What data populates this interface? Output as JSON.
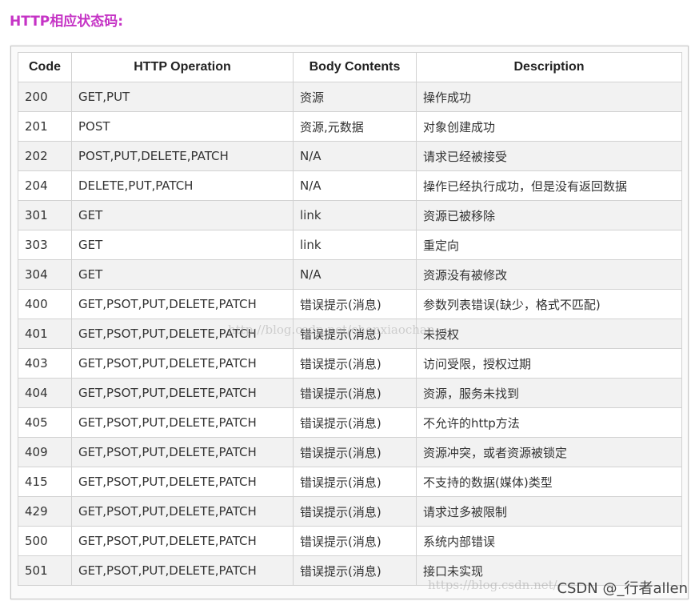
{
  "heading": "HTTP相应状态码:",
  "table": {
    "headers": [
      "Code",
      "HTTP Operation",
      "Body Contents",
      "Description"
    ],
    "rows": [
      [
        "200",
        "GET,PUT",
        "资源",
        "操作成功"
      ],
      [
        "201",
        "POST",
        "资源,元数据",
        "对象创建成功"
      ],
      [
        "202",
        "POST,PUT,DELETE,PATCH",
        "N/A",
        "请求已经被接受"
      ],
      [
        "204",
        "DELETE,PUT,PATCH",
        "N/A",
        "操作已经执行成功，但是没有返回数据"
      ],
      [
        "301",
        "GET",
        "link",
        "资源已被移除"
      ],
      [
        "303",
        "GET",
        "link",
        "重定向"
      ],
      [
        "304",
        "GET",
        "N/A",
        "资源没有被修改"
      ],
      [
        "400",
        "GET,PSOT,PUT,DELETE,PATCH",
        "错误提示(消息)",
        "参数列表错误(缺少，格式不匹配)"
      ],
      [
        "401",
        "GET,PSOT,PUT,DELETE,PATCH",
        "错误提示(消息)",
        "未授权"
      ],
      [
        "403",
        "GET,PSOT,PUT,DELETE,PATCH",
        "错误提示(消息)",
        "访问受限，授权过期"
      ],
      [
        "404",
        "GET,PSOT,PUT,DELETE,PATCH",
        "错误提示(消息)",
        "资源，服务未找到"
      ],
      [
        "405",
        "GET,PSOT,PUT,DELETE,PATCH",
        "错误提示(消息)",
        "不允许的http方法"
      ],
      [
        "409",
        "GET,PSOT,PUT,DELETE,PATCH",
        "错误提示(消息)",
        "资源冲突，或者资源被锁定"
      ],
      [
        "415",
        "GET,PSOT,PUT,DELETE,PATCH",
        "错误提示(消息)",
        "不支持的数据(媒体)类型"
      ],
      [
        "429",
        "GET,PSOT,PUT,DELETE,PATCH",
        "错误提示(消息)",
        "请求过多被限制"
      ],
      [
        "500",
        "GET,PSOT,PUT,DELETE,PATCH",
        "错误提示(消息)",
        "系统内部错误"
      ],
      [
        "501",
        "GET,PSOT,PUT,DELETE,PATCH",
        "错误提示(消息)",
        "接口未实现"
      ]
    ]
  },
  "watermarks": {
    "middle": "http://blog.csdn.net/chenxiaochan",
    "bottom": "https://blog.csdn.net/",
    "csdn": "CSDN @_行者allen"
  },
  "colors": {
    "heading": "#c533c5",
    "row_alt": "#f2f2f2",
    "border": "#d2d2d2"
  }
}
